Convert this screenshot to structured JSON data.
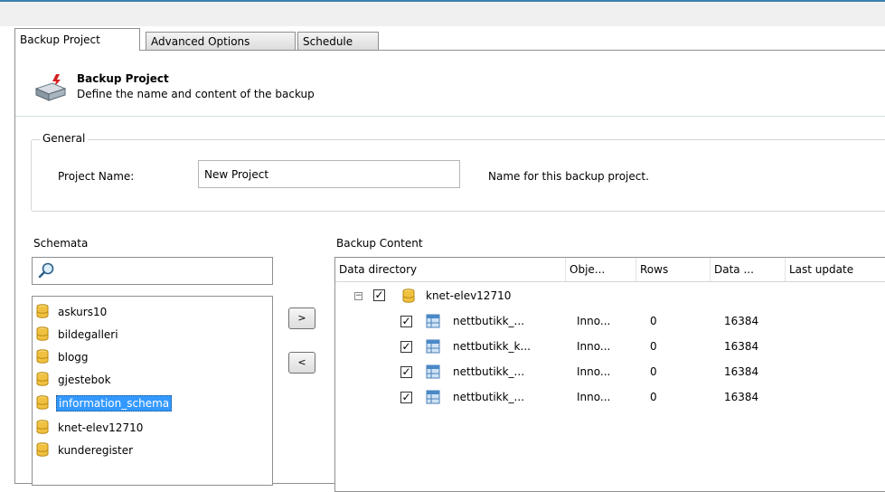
{
  "tabs": [
    {
      "label": "Backup Project",
      "active": true
    },
    {
      "label": "Advanced Options",
      "active": false
    },
    {
      "label": "Schedule",
      "active": false
    }
  ],
  "header": {
    "title": "Backup Project",
    "subtitle": "Define the name and content of the backup",
    "icon": "backup-drive-icon"
  },
  "general": {
    "legend": "General",
    "project_name_label": "Project Name:",
    "project_name_value": "New Project",
    "project_name_hint": "Name for this backup project."
  },
  "schemata": {
    "label": "Schemata",
    "search_icon": "search-icon",
    "items": [
      {
        "name": "askurs10",
        "selected": false
      },
      {
        "name": "bildegalleri",
        "selected": false
      },
      {
        "name": "blogg",
        "selected": false
      },
      {
        "name": "gjestebok",
        "selected": false
      },
      {
        "name": "information_schema",
        "selected": true
      },
      {
        "name": "knet-elev12710",
        "selected": false
      },
      {
        "name": "kunderegister",
        "selected": false
      }
    ]
  },
  "buttons": {
    "add": ">",
    "remove": "<"
  },
  "backup_content": {
    "label": "Backup Content",
    "columns": [
      "Data directory",
      "Obje...",
      "Rows",
      "Data ...",
      "Last update"
    ],
    "root": {
      "name": "knet-elev12710",
      "checked": true,
      "expanded": true,
      "expander": "−"
    },
    "rows": [
      {
        "name": "nettbutikk_...",
        "object": "Inno...",
        "rows": "0",
        "data": "16384",
        "last_update": "",
        "checked": true
      },
      {
        "name": "nettbutikk_k...",
        "object": "Inno...",
        "rows": "0",
        "data": "16384",
        "last_update": "",
        "checked": true
      },
      {
        "name": "nettbutikk_...",
        "object": "Inno...",
        "rows": "0",
        "data": "16384",
        "last_update": "",
        "checked": true
      },
      {
        "name": "nettbutikk_...",
        "object": "Inno...",
        "rows": "0",
        "data": "16384",
        "last_update": "",
        "checked": true
      }
    ]
  },
  "colors": {
    "selection": "#3399ff",
    "accent_line": "#3c7fb1",
    "db_icon": "#f0c040"
  }
}
